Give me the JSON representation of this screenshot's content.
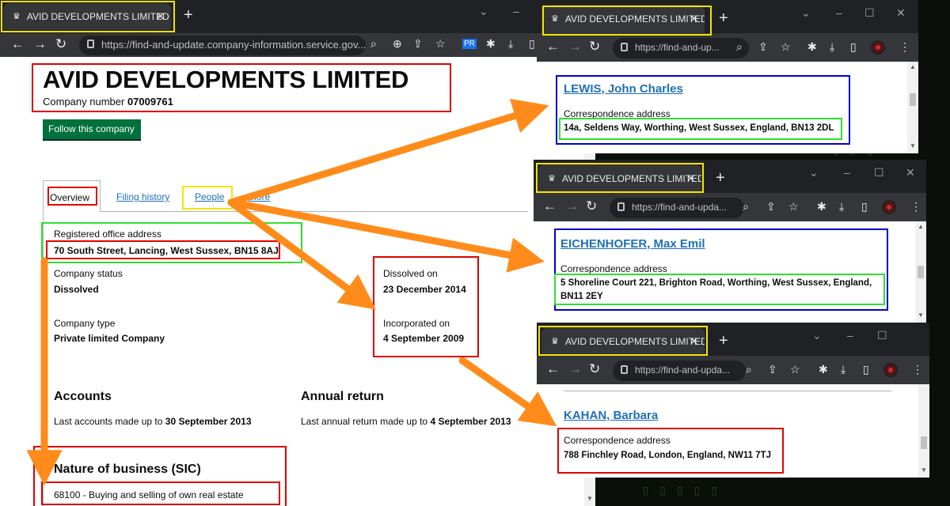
{
  "main": {
    "tab_title": "AVID DEVELOPMENTS LIMITED o",
    "url": "https://find-and-update.company-information.service.gov....",
    "company_name": "AVID DEVELOPMENTS LIMITED",
    "company_number_label": "Company number",
    "company_number": "07009761",
    "follow_button": "Follow this company",
    "tabs": {
      "overview": "Overview",
      "filing_history": "Filing history",
      "people": "People",
      "more": "More"
    },
    "registered_office_label": "Registered office address",
    "registered_office": "70 South Street, Lancing, West Sussex, BN15 8AJ",
    "status_label": "Company status",
    "status": "Dissolved",
    "type_label": "Company type",
    "type": "Private limited Company",
    "dissolved_label": "Dissolved on",
    "dissolved": "23 December 2014",
    "incorporated_label": "Incorporated on",
    "incorporated": "4 September 2009",
    "accounts_heading": "Accounts",
    "accounts_text": "Last accounts made up to",
    "accounts_date": "30 September 2013",
    "annual_return_heading": "Annual return",
    "annual_return_text": "Last annual return made up to",
    "annual_return_date": "4 September 2013",
    "sic_heading": "Nature of business (SIC)",
    "sic_value": "68100 - Buying and selling of own real estate"
  },
  "popups": [
    {
      "tab_title": "AVID DEVELOPMENTS LIMITED p",
      "url": "https://find-and-up...",
      "officer_name": "LEWIS, John Charles",
      "address_label": "Correspondence address",
      "address": "14a, Seldens Way, Worthing, West Sussex, England, BN13 2DL"
    },
    {
      "tab_title": "AVID DEVELOPMENTS LIMITED p",
      "url": "https://find-and-upda...",
      "officer_name": "EICHENHOFER, Max Emil",
      "address_label": "Correspondence address",
      "address_line1": "5 Shoreline Court 221, Brighton Road, Worthing, West Sussex, England,",
      "address_line2": "BN11 2EY"
    },
    {
      "tab_title": "AVID DEVELOPMENTS LIMITED p",
      "url": "https://find-and-upda...",
      "officer_name": "KAHAN, Barbara",
      "address_label": "Correspondence address",
      "address": "788 Finchley Road, London, England, NW11 7TJ"
    }
  ],
  "colors": {
    "arrow": "#ff8c1a",
    "red_box": "#e00000",
    "green_box": "#2fe02f",
    "yellow_box": "#f5e400",
    "blue_box": "#0000c8",
    "follow_button": "#00703c",
    "link": "#1d70b8"
  }
}
